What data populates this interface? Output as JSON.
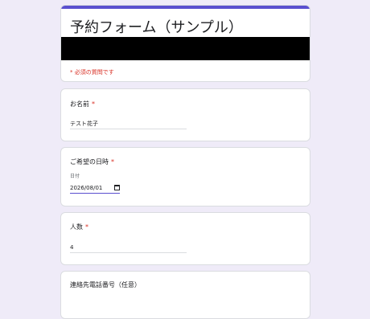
{
  "header": {
    "title": "予約フォーム（サンプル）",
    "required_note": "* 必須の質問です",
    "accent_color": "#5a4fcf"
  },
  "questions": [
    {
      "label": "お名前",
      "required": "*",
      "value": "テスト花子"
    },
    {
      "label": "ご希望の日時",
      "required": "*",
      "sub_label": "日付",
      "value": "2026/08/01",
      "icon": "calendar-icon"
    },
    {
      "label": "人数",
      "required": "*",
      "value": "4"
    },
    {
      "label": "連絡先電話番号（任意）"
    }
  ]
}
